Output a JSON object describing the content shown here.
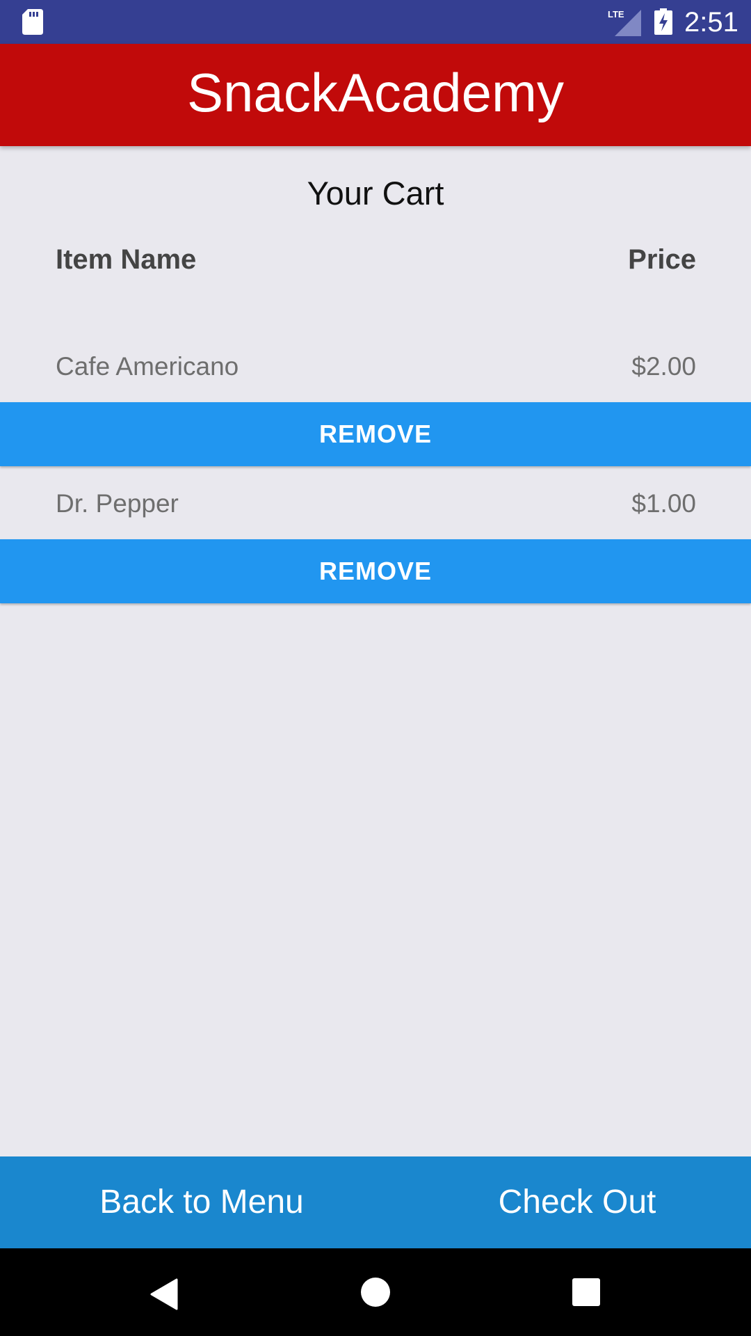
{
  "status_bar": {
    "time": "2:51",
    "network": "LTE",
    "icons": [
      "sd-card-icon",
      "lte-signal-icon",
      "battery-charging-icon"
    ]
  },
  "app_bar": {
    "title": "SnackAcademy",
    "color": "#c10a0a"
  },
  "cart": {
    "title": "Your Cart",
    "header_name": "Item Name",
    "header_price": "Price",
    "items": [
      {
        "name": "Cafe Americano",
        "price": "$2.00",
        "remove_label": "REMOVE"
      },
      {
        "name": "Dr. Pepper",
        "price": "$1.00",
        "remove_label": "REMOVE"
      }
    ]
  },
  "bottom_bar": {
    "back_label": "Back to Menu",
    "checkout_label": "Check Out"
  },
  "nav_bar": {
    "icons": [
      "back-triangle-icon",
      "home-circle-icon",
      "recents-square-icon"
    ]
  },
  "colors": {
    "status_bar": "#353f92",
    "background": "#e9e8ee",
    "remove_button": "#2196f0",
    "bottom_bar": "#1a87ce",
    "nav_bar": "#000000"
  }
}
